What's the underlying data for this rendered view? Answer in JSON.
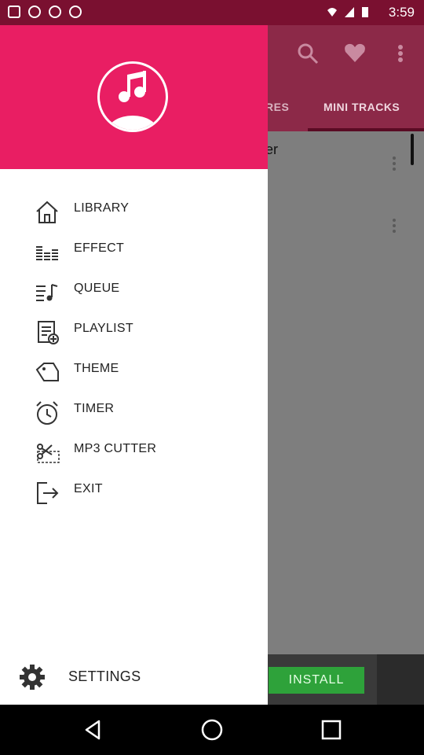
{
  "status_bar": {
    "time": "3:59"
  },
  "app": {
    "tabs": [
      {
        "label": "RES"
      },
      {
        "label": "MINI TRACKS"
      }
    ],
    "list_title_fragment": "er",
    "ad": {
      "install_label": "INSTALL"
    }
  },
  "drawer": {
    "menu": [
      {
        "label": "LIBRARY",
        "icon": "home-icon"
      },
      {
        "label": "EFFECT",
        "icon": "equalizer-icon"
      },
      {
        "label": "QUEUE",
        "icon": "queue-music-icon"
      },
      {
        "label": "PLAYLIST",
        "icon": "playlist-add-icon"
      },
      {
        "label": "THEME",
        "icon": "theme-tag-icon"
      },
      {
        "label": "TIMER",
        "icon": "alarm-clock-icon"
      },
      {
        "label": "MP3 CUTTER",
        "icon": "scissors-cutter-icon"
      },
      {
        "label": "EXIT",
        "icon": "exit-icon"
      }
    ],
    "settings_label": "SETTINGS"
  },
  "colors": {
    "status_bar": "#7a1030",
    "toolbar": "#8c2948",
    "drawer_header": "#e91e63",
    "scrim_content": "#7e7e7e",
    "install_button": "#2ea23a"
  }
}
